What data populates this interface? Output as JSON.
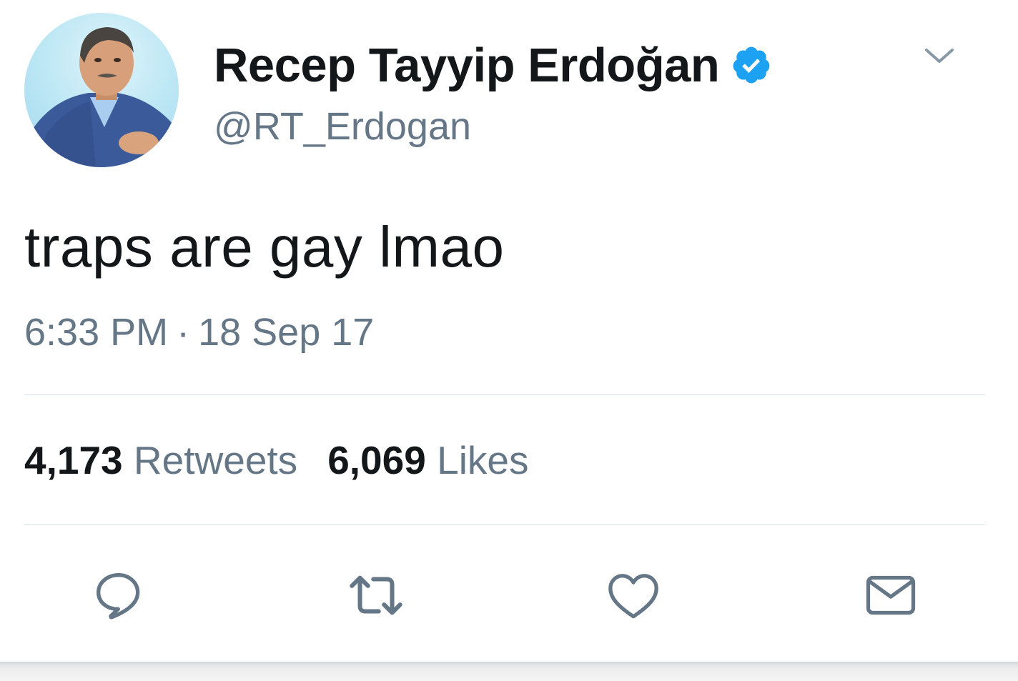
{
  "tweet": {
    "author": {
      "name": "Recep Tayyip Erdoğan",
      "handle": "@RT_Erdogan",
      "verified": true
    },
    "text": "traps are gay lmao",
    "time": "6:33 PM",
    "separator": "·",
    "date": "18 Sep 17",
    "stats": {
      "retweets_count": "4,173",
      "retweets_label": "Retweets",
      "likes_count": "6,069",
      "likes_label": "Likes"
    }
  },
  "colors": {
    "text_primary": "#14171a",
    "text_secondary": "#657786",
    "verified_blue": "#1da1f2",
    "divider": "#d9dee2"
  },
  "icons": {
    "caret": "chevron-down-icon",
    "verified": "verified-badge-icon",
    "reply": "reply-icon",
    "retweet": "retweet-icon",
    "like": "heart-icon",
    "message": "envelope-icon"
  }
}
